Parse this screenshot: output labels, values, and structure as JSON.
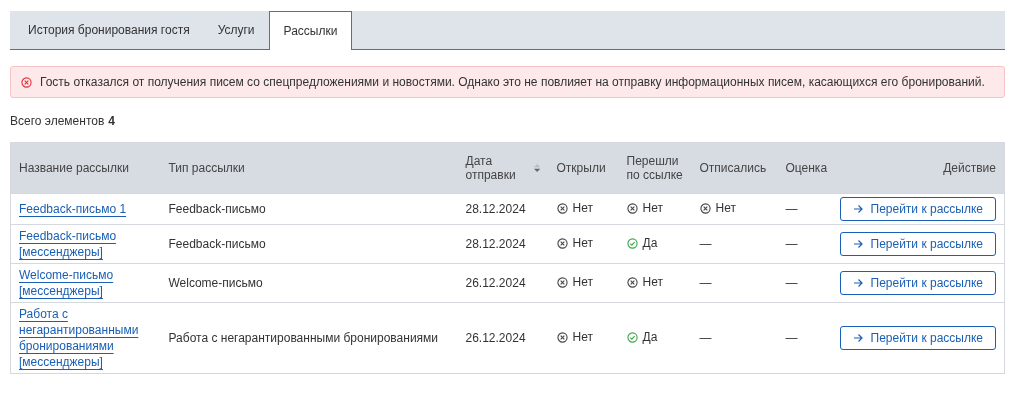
{
  "tabs": [
    {
      "label": "История бронирования гостя",
      "selected": false
    },
    {
      "label": "Услуги",
      "selected": false
    },
    {
      "label": "Рассылки",
      "selected": true
    }
  ],
  "alert": {
    "text": "Гость отказался от получения писем со спецпредложениями и новостями. Однако это не повлияет на отправку информационных писем, касающихся его бронирований."
  },
  "total": {
    "label": "Всего элементов",
    "count": "4"
  },
  "table": {
    "columns": [
      {
        "label": "Название рассылки"
      },
      {
        "label": "Тип рассылки"
      },
      {
        "label": "Дата отправки",
        "sort_descending": true
      },
      {
        "label": "Открыли"
      },
      {
        "label": "Перешли по ссылке"
      },
      {
        "label": "Отписались"
      },
      {
        "label": "Оценка"
      },
      {
        "label": "Действие"
      }
    ],
    "rows": [
      {
        "name": "Feedback-письмо 1",
        "type": "Feedback-письмо",
        "date": "28.12.2024",
        "opened": {
          "kind": "no",
          "label": "Нет"
        },
        "clicked": {
          "kind": "no",
          "label": "Нет"
        },
        "unsubscribed": {
          "kind": "no",
          "label": "Нет"
        },
        "rating": {
          "kind": "dash",
          "label": "—"
        },
        "action": "Перейти к рассылке"
      },
      {
        "name": "Feedback-письмо [мессенджеры]",
        "type": "Feedback-письмо",
        "date": "28.12.2024",
        "opened": {
          "kind": "no",
          "label": "Нет"
        },
        "clicked": {
          "kind": "yes",
          "label": "Да"
        },
        "unsubscribed": {
          "kind": "dash",
          "label": "—"
        },
        "rating": {
          "kind": "dash",
          "label": "—"
        },
        "action": "Перейти к рассылке"
      },
      {
        "name": "Welcome-письмо [мессенджеры]",
        "type": "Welcome-письмо",
        "date": "26.12.2024",
        "opened": {
          "kind": "no",
          "label": "Нет"
        },
        "clicked": {
          "kind": "no",
          "label": "Нет"
        },
        "unsubscribed": {
          "kind": "dash",
          "label": "—"
        },
        "rating": {
          "kind": "dash",
          "label": "—"
        },
        "action": "Перейти к рассылке"
      },
      {
        "name": "Работа с негарантированными бронированиями [мессенджеры]",
        "type": "Работа с негарантированными бронированиями",
        "date": "26.12.2024",
        "opened": {
          "kind": "no",
          "label": "Нет"
        },
        "clicked": {
          "kind": "yes",
          "label": "Да"
        },
        "unsubscribed": {
          "kind": "dash",
          "label": "—"
        },
        "rating": {
          "kind": "dash",
          "label": "—"
        },
        "action": "Перейти к рассылке"
      }
    ]
  }
}
